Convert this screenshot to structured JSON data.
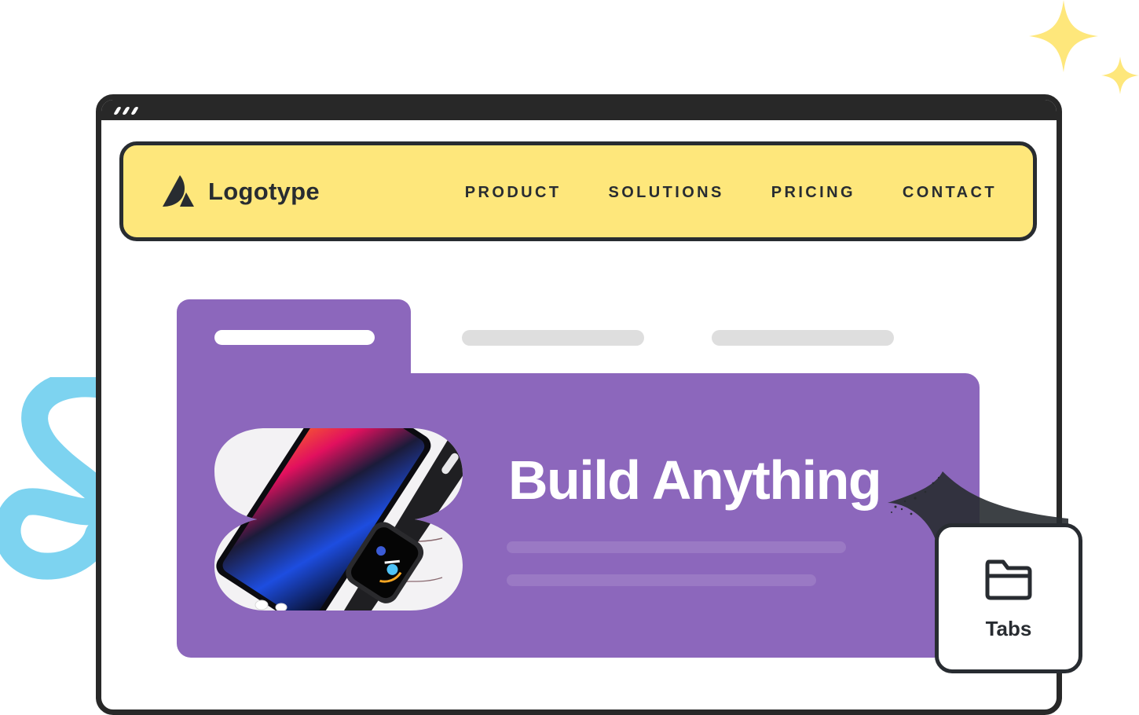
{
  "window": {
    "titlebar_dots": 3
  },
  "navbar": {
    "logo_icon": "logotype-mark-icon",
    "logo_text": "Logotype",
    "links": [
      {
        "label": "PRODUCT"
      },
      {
        "label": "SOLUTIONS"
      },
      {
        "label": "PRICING"
      },
      {
        "label": "CONTACT"
      }
    ]
  },
  "tabs": {
    "count": 3,
    "active_index": 0,
    "panel": {
      "title": "Build Anything",
      "image_alt": "Smartphone and smartwatch on marble surface",
      "placeholder_lines": 2
    }
  },
  "badge": {
    "icon": "folder-icon",
    "label": "Tabs"
  },
  "colors": {
    "window_frame": "#282828",
    "navbar_bg": "#FEE77B",
    "text_dark": "#282C31",
    "accent_purple": "#8C67BC",
    "tab_inactive": "#DEDEDE",
    "squiggle_blue": "#7DD3F0",
    "sparkle_yellow": "#FEE77B"
  }
}
